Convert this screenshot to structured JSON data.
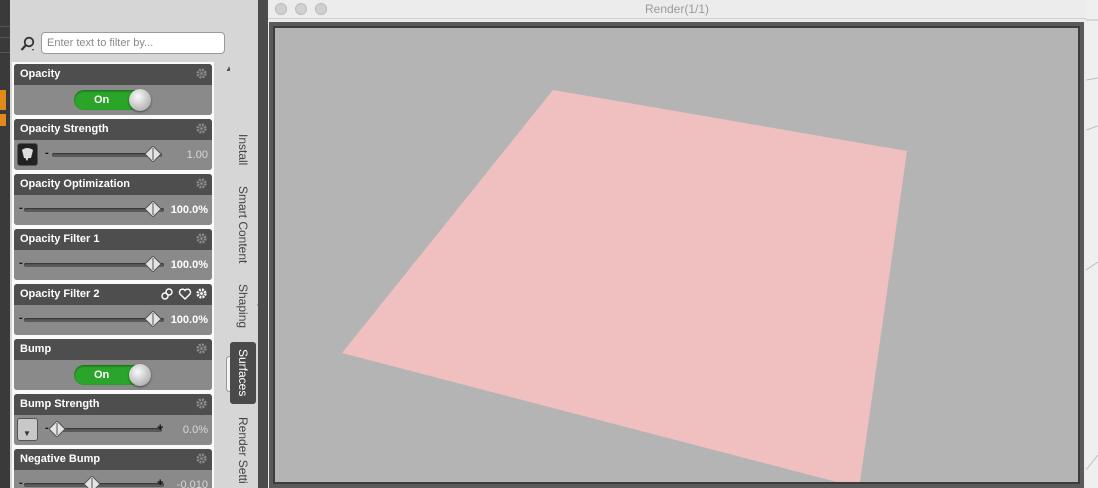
{
  "search": {
    "placeholder": "Enter text to filter by..."
  },
  "properties": [
    {
      "title": "Opacity",
      "control": "toggle",
      "value": "On"
    },
    {
      "title": "Opacity Strength",
      "control": "slider",
      "value": "1.00",
      "level": 1.0,
      "map": "image"
    },
    {
      "title": "Opacity Optimization",
      "control": "slider",
      "value": "100.0%",
      "level": 1.0
    },
    {
      "title": "Opacity Filter 1",
      "control": "slider",
      "value": "100.0%",
      "level": 1.0
    },
    {
      "title": "Opacity Filter 2",
      "control": "slider",
      "value": "100.0%",
      "level": 1.0,
      "icons": [
        "link-icon",
        "heart-icon",
        "gear-icon"
      ]
    },
    {
      "title": "Bump",
      "control": "toggle",
      "value": "On"
    },
    {
      "title": "Bump Strength",
      "control": "slider",
      "value": "0.0%",
      "level": 0.0,
      "map": "dropdown"
    },
    {
      "title": "Negative Bump",
      "control": "slider",
      "value": "-0.010",
      "level": 0.5,
      "map": "none"
    }
  ],
  "tabs": [
    "Install",
    "Smart Content",
    "Shaping",
    "Surfaces",
    "Render Setti"
  ],
  "active_tab": "Surfaces",
  "window": {
    "title": "Render(1/1)"
  },
  "colors": {
    "toggle_on": "#2aa52a",
    "plane": "#f0c0c0",
    "render_bg": "#b4b4b4",
    "left_accent": "#e08a1e"
  }
}
